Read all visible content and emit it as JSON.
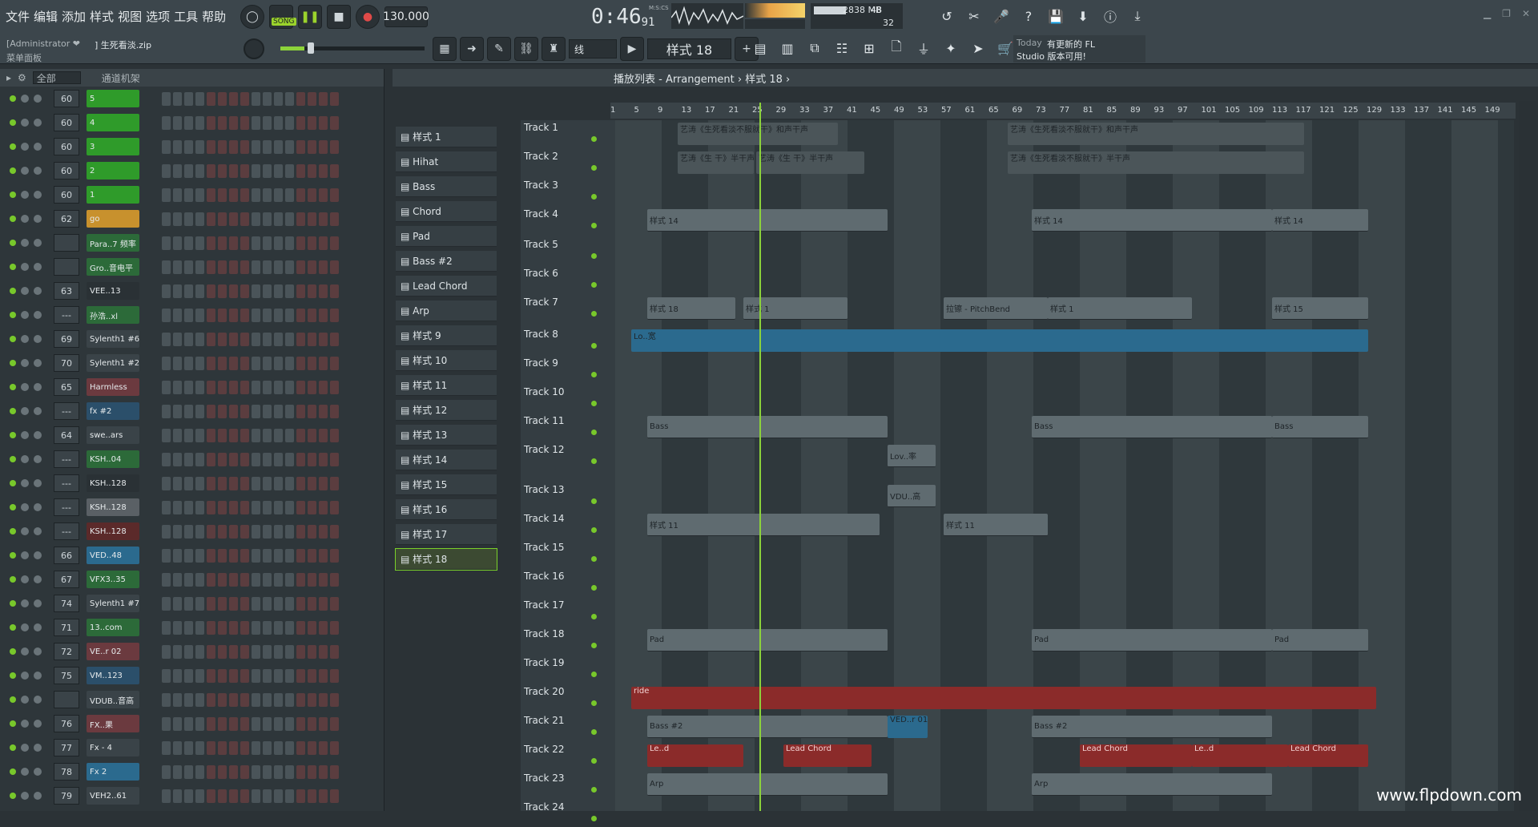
{
  "menu": [
    "文件",
    "编辑",
    "添加",
    "样式",
    "视图",
    "选项",
    "工具",
    "帮助"
  ],
  "transport": {
    "song_label": "SONG",
    "tempo": "130.000",
    "time_main": "0:46",
    "time_sub": "91",
    "time_unit": "M:S:CS"
  },
  "cpu": {
    "value": "48",
    "ram": "2838 MB",
    "poly": "32"
  },
  "hint": {
    "user": "[Administrator ❤",
    "file": "] 生死看淡.zip",
    "panel": "菜单面板"
  },
  "snap": {
    "value": "线"
  },
  "pattern_selector": {
    "value": "样式 18"
  },
  "news": {
    "date": "Today",
    "line1": "有更新的 FL",
    "line2": "Studio 版本可用!"
  },
  "rack": {
    "filter": "全部",
    "title": "通道机架",
    "channels": [
      {
        "num": "60",
        "name": "5",
        "color": "#2f9b2a"
      },
      {
        "num": "60",
        "name": "4",
        "color": "#2f9b2a"
      },
      {
        "num": "60",
        "name": "3",
        "color": "#2f9b2a"
      },
      {
        "num": "60",
        "name": "2",
        "color": "#2f9b2a"
      },
      {
        "num": "60",
        "name": "1",
        "color": "#2f9b2a"
      },
      {
        "num": "62",
        "name": "go",
        "color": "#c8912d"
      },
      {
        "num": "",
        "name": "Para..7 频率",
        "color": "#2c6a39"
      },
      {
        "num": "",
        "name": "Gro..音电平",
        "color": "#2c6a39"
      },
      {
        "num": "63",
        "name": "VEE..13",
        "color": "#2a3135"
      },
      {
        "num": "---",
        "name": "孙浩..xl",
        "color": "#2c6a39"
      },
      {
        "num": "69",
        "name": "Sylenth1 #6",
        "color": "#3a4348"
      },
      {
        "num": "70",
        "name": "Sylenth1 #2",
        "color": "#3a4348"
      },
      {
        "num": "65",
        "name": "Harmless",
        "color": "#6b3a3f"
      },
      {
        "num": "---",
        "name": "fx #2",
        "color": "#2b4f6a"
      },
      {
        "num": "64",
        "name": "swe..ars",
        "color": "#3a4348"
      },
      {
        "num": "---",
        "name": "KSH..04",
        "color": "#2c6a39"
      },
      {
        "num": "---",
        "name": "KSH..128",
        "color": "#2a3135"
      },
      {
        "num": "---",
        "name": "KSH..128",
        "color": "#5a6065"
      },
      {
        "num": "---",
        "name": "KSH..128",
        "color": "#5b2a2a"
      },
      {
        "num": "66",
        "name": "VED..48",
        "color": "#2b6a8e"
      },
      {
        "num": "67",
        "name": "VFX3..35",
        "color": "#2c6a39"
      },
      {
        "num": "74",
        "name": "Sylenth1 #7",
        "color": "#3a4348"
      },
      {
        "num": "71",
        "name": "13..com",
        "color": "#2c6a39"
      },
      {
        "num": "72",
        "name": "VE..r 02",
        "color": "#6b3a3f"
      },
      {
        "num": "75",
        "name": "VM..123",
        "color": "#2b4f6a"
      },
      {
        "num": "",
        "name": "VDUB..音高",
        "color": "#3a4348"
      },
      {
        "num": "76",
        "name": "FX..果",
        "color": "#6b3a3f"
      },
      {
        "num": "77",
        "name": "Fx - 4",
        "color": "#3a4348"
      },
      {
        "num": "78",
        "name": "Fx 2",
        "color": "#2b6a8e"
      },
      {
        "num": "79",
        "name": "VEH2..61",
        "color": "#3a4348"
      }
    ]
  },
  "picker": {
    "patterns": [
      "样式 1",
      "Hihat",
      "Bass",
      "Chord",
      "Pad",
      "Bass #2",
      "Lead Chord",
      "Arp",
      "样式 9",
      "样式 10",
      "样式 11",
      "样式 12",
      "样式 13",
      "样式 14",
      "样式 15",
      "样式 16",
      "样式 17",
      "样式 18"
    ],
    "selected": "样式 18"
  },
  "playlist": {
    "title": "播放列表 - Arrangement › 样式 18 ›",
    "ruler": [
      "1",
      "5",
      "9",
      "13",
      "17",
      "21",
      "25",
      "29",
      "33",
      "37",
      "41",
      "45",
      "49",
      "53",
      "57",
      "61",
      "65",
      "69",
      "73",
      "77",
      "81",
      "85",
      "89",
      "93",
      "97",
      "101",
      "105",
      "109",
      "113",
      "117",
      "121",
      "125",
      "129",
      "133",
      "137",
      "141",
      "145",
      "149"
    ],
    "tracks": [
      "Track 1",
      "Track 2",
      "Track 3",
      "Track 4",
      "Track 5",
      "Track 6",
      "Track 7",
      "Track 8",
      "Track 9",
      "Track 10",
      "Track 11",
      "Track 12",
      "Track 13",
      "Track 14",
      "Track 15",
      "Track 16",
      "Track 17",
      "Track 18",
      "Track 19",
      "Track 20",
      "Track 21",
      "Track 22",
      "Track 23",
      "Track 24"
    ]
  },
  "clips": {
    "t1a": "艺涛《生死看淡不服就干》和声干声",
    "t1b": "艺涛《生死看淡不服就干》和声干声",
    "t2a": "艺涛《生 干》半干声",
    "t2b": "艺涛《生 干》半干声",
    "t2c": "艺涛《生死看淡不服就干》半干声",
    "t4": "样式 14",
    "t7a": "样式 18",
    "t7b": "样式 1",
    "t7c": "拉镲 - PitchBend",
    "t7d": "样式 15",
    "t8": "Lo..宽",
    "t11": "Bass",
    "t12": "Lov..率",
    "t13": "VDU..高",
    "t14": "样式 11",
    "t18": "Pad",
    "t20": "ride",
    "t21": "Bass #2",
    "t21b": "VED..r 01",
    "t22": "Lead Chord",
    "t22b": "Le..d",
    "t23": "Arp"
  },
  "watermark": "www.flpdown.com"
}
